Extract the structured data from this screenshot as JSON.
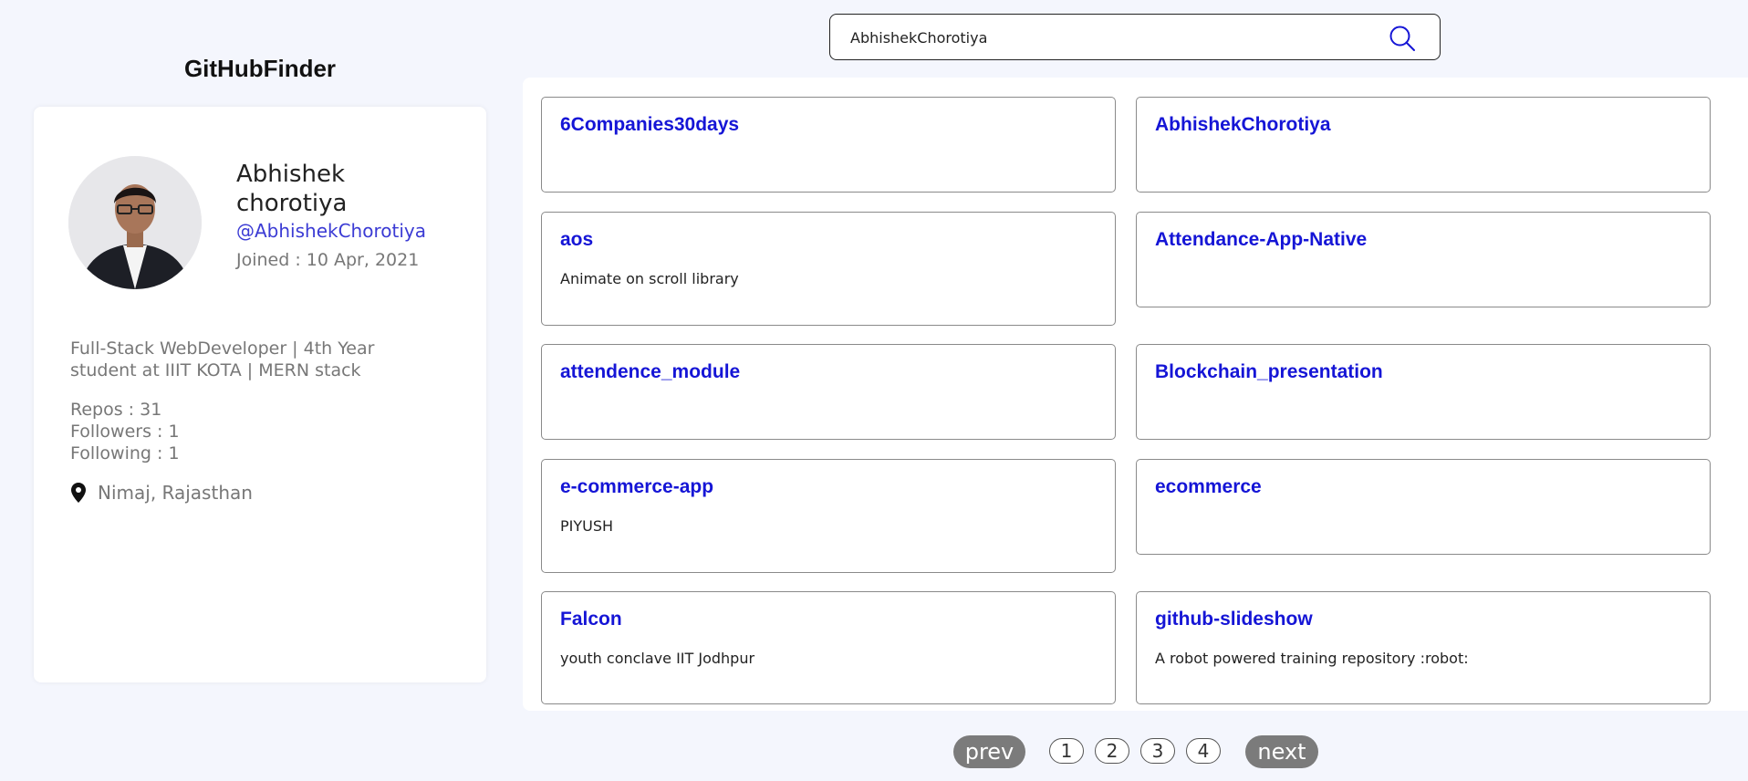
{
  "app": {
    "title": "GitHubFinder"
  },
  "search": {
    "value": "AbhishekChorotiya",
    "icon": "search-icon"
  },
  "profile": {
    "name": "Abhishek chorotiya",
    "handle": "@AbhishekChorotiya",
    "joined": "Joined : 10 Apr, 2021",
    "bio": "Full-Stack WebDeveloper | 4th Year student at IIIT KOTA | MERN stack",
    "repos": "Repos : 31",
    "followers": "Followers : 1",
    "following": "Following : 1",
    "location": "Nimaj, Rajasthan",
    "location_icon": "location-pin-icon"
  },
  "repos": [
    {
      "name": "6Companies30days",
      "description": ""
    },
    {
      "name": "AbhishekChorotiya",
      "description": ""
    },
    {
      "name": "aos",
      "description": "Animate on scroll library"
    },
    {
      "name": "Attendance-App-Native",
      "description": ""
    },
    {
      "name": "attendence_module",
      "description": ""
    },
    {
      "name": "Blockchain_presentation",
      "description": ""
    },
    {
      "name": "e-commerce-app",
      "description": "PIYUSH"
    },
    {
      "name": "ecommerce",
      "description": ""
    },
    {
      "name": "Falcon",
      "description": "youth conclave IIT Jodhpur"
    },
    {
      "name": "github-slideshow",
      "description": "A robot powered training repository :robot:"
    }
  ],
  "pagination": {
    "prev": "prev",
    "next": "next",
    "pages": [
      "1",
      "2",
      "3",
      "4"
    ]
  },
  "colors": {
    "background": "#f4f6fd",
    "link": "#1515d6",
    "handle": "#3b3bd4",
    "pager_button": "#7b7b7b"
  }
}
